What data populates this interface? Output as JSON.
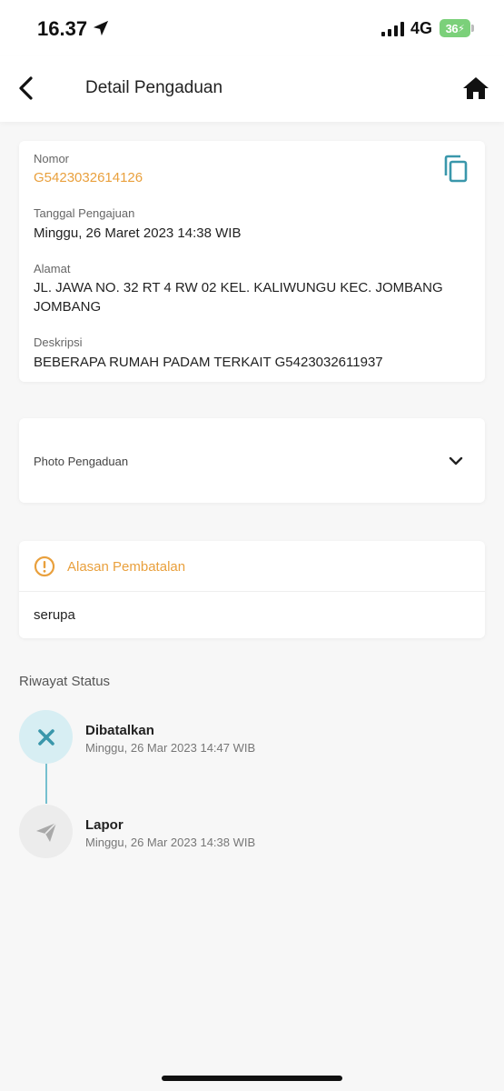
{
  "status_bar": {
    "time": "16.37",
    "network": "4G",
    "battery": "36"
  },
  "header": {
    "title": "Detail Pengaduan"
  },
  "detail": {
    "nomor_label": "Nomor",
    "nomor_value": "G5423032614126",
    "tanggal_label": "Tanggal Pengajuan",
    "tanggal_value": "Minggu, 26 Maret 2023 14:38 WIB",
    "alamat_label": "Alamat",
    "alamat_value": "JL. JAWA NO. 32 RT 4 RW 02 KEL. KALIWUNGU KEC. JOMBANG JOMBANG",
    "deskripsi_label": "Deskripsi",
    "deskripsi_value": "BEBERAPA RUMAH PADAM  TERKAIT G5423032611937"
  },
  "photo": {
    "label": "Photo Pengaduan"
  },
  "cancel_reason": {
    "title": "Alasan Pembatalan",
    "value": "serupa"
  },
  "history": {
    "title": "Riwayat Status",
    "items": [
      {
        "status": "Dibatalkan",
        "time": "Minggu, 26 Mar 2023 14:47 WIB",
        "icon": "close-icon"
      },
      {
        "status": "Lapor",
        "time": "Minggu, 26 Mar 2023 14:38 WIB",
        "icon": "send-icon"
      }
    ]
  },
  "colors": {
    "accent_orange": "#e9a03d",
    "accent_teal": "#3a97ab",
    "battery_green": "#7bd07a"
  }
}
